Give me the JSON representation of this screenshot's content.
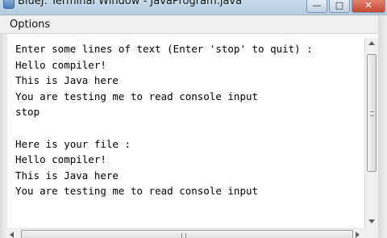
{
  "window": {
    "title": "BlueJ: Terminal Window - JavaProgram.java",
    "minimize_glyph": "—",
    "maximize_glyph": "□",
    "close_glyph": "✕"
  },
  "menu": {
    "items": [
      {
        "label": "Options"
      }
    ]
  },
  "console": {
    "lines": [
      "Enter some lines of text (Enter 'stop' to quit) :",
      "Hello compiler!",
      "This is Java here",
      "You are testing me to read console input",
      "stop",
      "",
      "Here is your file :",
      "Hello compiler!",
      "This is Java here",
      "You are testing me to read console input"
    ]
  },
  "icons": {
    "app": "bluej-app-icon",
    "scroll_up": "arrow-up-icon",
    "scroll_down": "arrow-down-icon",
    "scroll_left": "arrow-left-icon",
    "scroll_right": "arrow-right-icon"
  }
}
